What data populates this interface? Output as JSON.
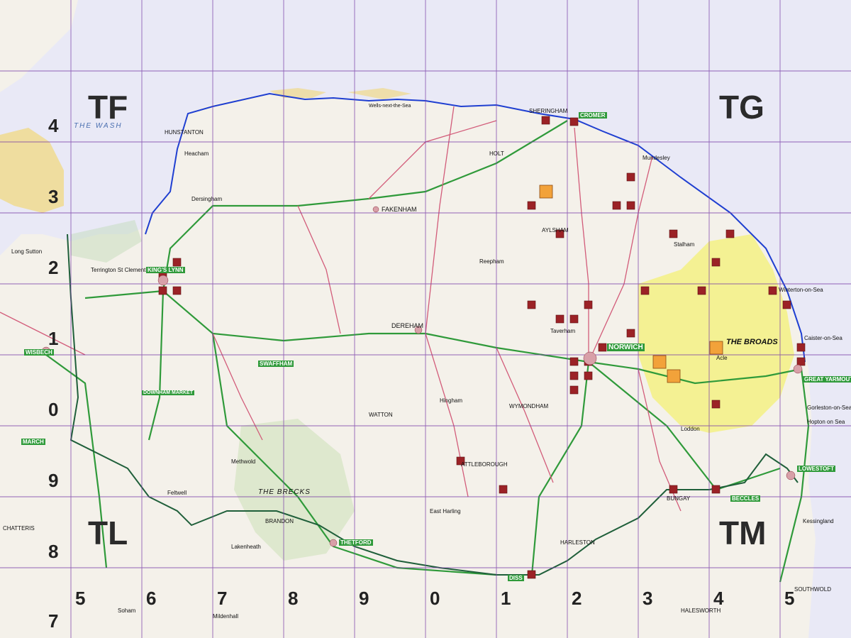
{
  "map": {
    "grid_squares": {
      "top_left": "TF",
      "top_right": "TG",
      "bottom_left": "TL",
      "bottom_right": "TM"
    },
    "northings_left": [
      "4",
      "3",
      "2",
      "1",
      "0",
      "9",
      "8",
      "7"
    ],
    "eastings_bottom": [
      "5",
      "6",
      "7",
      "8",
      "9",
      "0",
      "1",
      "2",
      "3",
      "4",
      "5"
    ],
    "regions": {
      "wash": "THE WASH",
      "broads": "THE BROADS",
      "brecks": "THE BRECKS"
    },
    "towns": {
      "norwich": "NORWICH",
      "kings_lynn": "KING'S LYNN",
      "great_yarmouth": "GREAT YARMOUTH",
      "lowestoft": "LOWESTOFT",
      "cromer": "CROMER",
      "sheringham": "SHERINGHAM",
      "fakenham": "FAKENHAM",
      "dereham": "DEREHAM",
      "swaffham": "SWAFFHAM",
      "thetford": "THETFORD",
      "downham_market": "DOWNHAM MARKET",
      "wymondham": "WYMONDHAM",
      "hunstanton": "HUNSTANTON",
      "aylsham": "AYLSHAM",
      "wisbech": "WISBECH",
      "brandon": "BRANDON",
      "diss": "DISS",
      "bungay": "BUNGAY",
      "beccles": "BECCLES",
      "harleston": "HARLESTON",
      "attleborough": "ATTLEBOROUGH",
      "watton": "WATTON",
      "mundesley": "Mundesley",
      "gorleston": "Gorleston-on-Sea",
      "hopton": "Hopton on Sea",
      "kessingland": "Kessingland",
      "southwold": "SOUTHWOLD",
      "halesworth": "HALESWORTH",
      "march": "MARCH",
      "chatteris": "CHATTERIS",
      "soham": "Soham",
      "mildenhall": "Mildenhall",
      "methwold": "Methwold",
      "feltwell": "Feltwell",
      "lakenheath": "Lakenheath",
      "holt": "HOLT",
      "caister": "Caister-on-Sea",
      "winterton": "Winterton-on-Sea",
      "long_sutton": "Long Sutton",
      "terrington": "Terrington St Clement",
      "heacham": "Heacham",
      "dersingham": "Dersingham",
      "reepham": "Reepham",
      "taverham": "Taverham",
      "stalham": "Stalham",
      "acle": "Acle",
      "loddon": "Loddon",
      "hingham": "Hingham",
      "east_harling": "East Harling",
      "wells": "Wells-next-the-Sea"
    },
    "colors": {
      "background": "#e9e9f6",
      "land": "#f4f1ea",
      "sea": "#e9e9f6",
      "grid_line": "#7a3fa8",
      "coast_boundary": "#1f3fd1",
      "county_boundary": "#1f5f3a",
      "broads": "#f4f04a",
      "sand": "#f0d98a",
      "marker_dark": "#9b2226",
      "marker_orange": "#f2a23a",
      "primary_road": "#2f9a3a",
      "a_road": "#d25c7a"
    }
  }
}
